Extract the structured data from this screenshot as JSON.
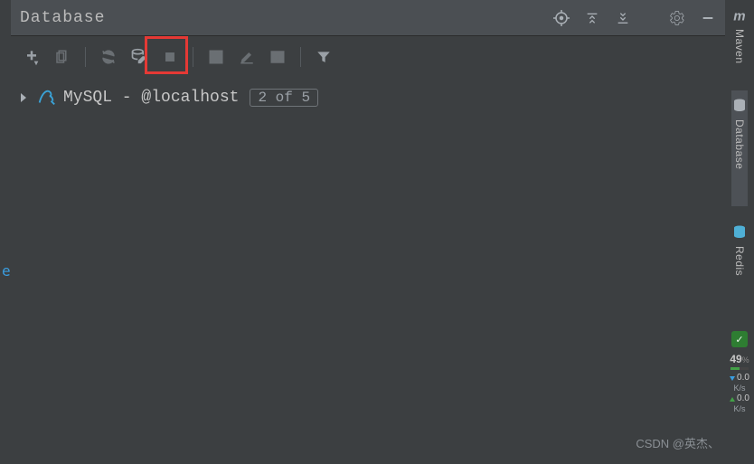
{
  "header": {
    "title": "Database"
  },
  "tree": {
    "datasource": "MySQL - @localhost",
    "count": "2 of 5"
  },
  "right_sidebar": {
    "maven": "Maven",
    "database": "Database",
    "redis": "Redis"
  },
  "network": {
    "percent": "49",
    "down_rate": "0.0",
    "down_unit": "K/s",
    "up_rate": "0.0",
    "up_unit": "K/s"
  },
  "watermark": "CSDN @英杰、",
  "left_char": "e"
}
